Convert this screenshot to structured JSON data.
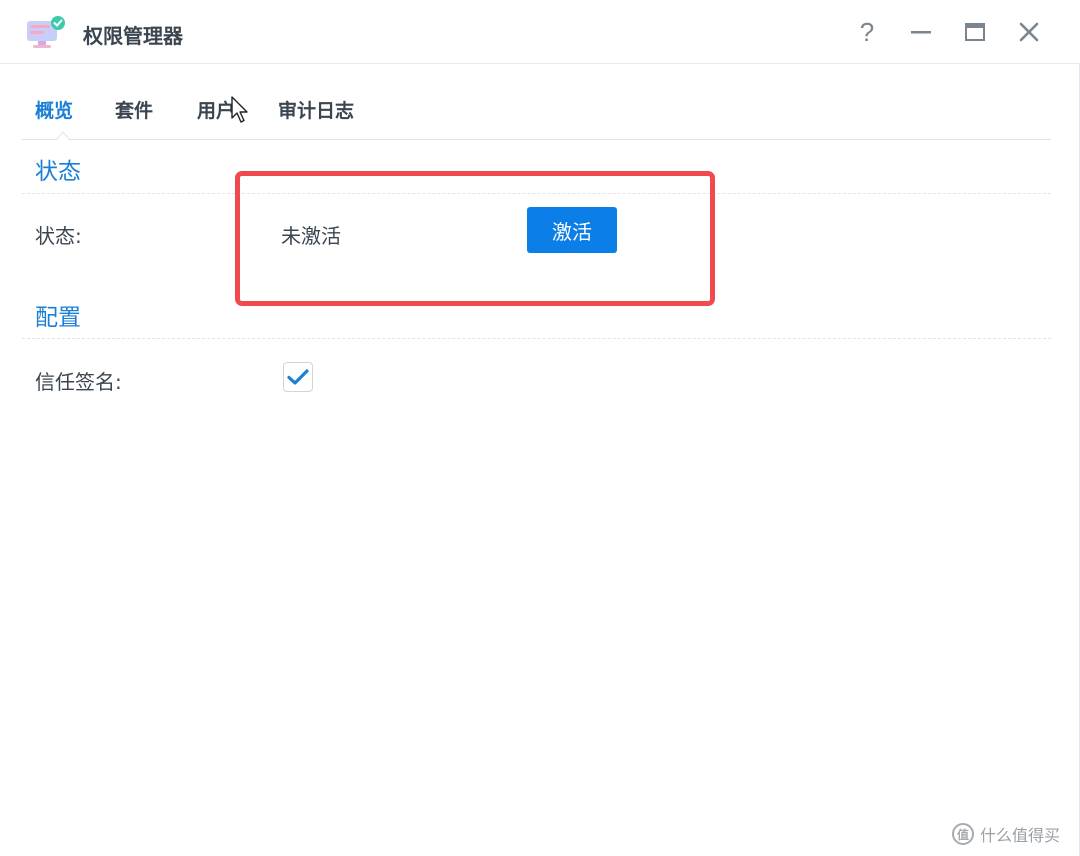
{
  "window": {
    "title": "权限管理器",
    "help_glyph": "?"
  },
  "tabs": [
    {
      "label": "概览",
      "active": true
    },
    {
      "label": "套件",
      "active": false
    },
    {
      "label": "用户",
      "active": false
    },
    {
      "label": "审计日志",
      "active": false
    }
  ],
  "status_section": {
    "title": "状态",
    "status_label": "状态:",
    "status_value": "未激活",
    "activate_button": "激活"
  },
  "config_section": {
    "title": "配置",
    "trust_signature_label": "信任签名:",
    "trust_signature_checked": true
  },
  "watermark": {
    "icon_glyph": "值",
    "text": "什么值得买"
  },
  "colors": {
    "accent": "#1b7fd6",
    "button": "#0c7ee8",
    "highlight": "#f04a4e",
    "text": "#3a4550"
  }
}
